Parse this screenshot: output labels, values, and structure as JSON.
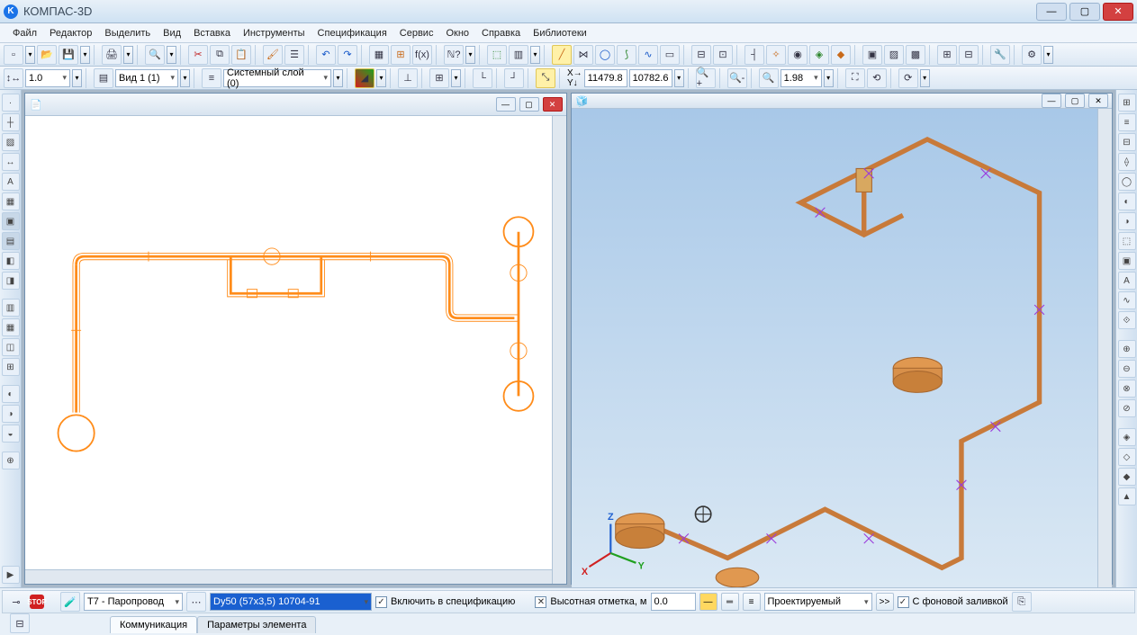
{
  "app": {
    "title": "КОМПАС-3D"
  },
  "menu": [
    "Файл",
    "Редактор",
    "Выделить",
    "Вид",
    "Вставка",
    "Инструменты",
    "Спецификация",
    "Сервис",
    "Окно",
    "Справка",
    "Библиотеки"
  ],
  "toolbar2": {
    "scale": "1.0",
    "view": "Вид 1 (1)",
    "layer": "Системный слой (0)",
    "coord_x": "11479.8",
    "coord_y": "10782.6",
    "zoom": "1.98"
  },
  "params": {
    "system": "Т7 - Паропровод",
    "pipe_spec": "Dy50 (57x3,5) 10704-91",
    "include_spec": "Включить в спецификацию",
    "elev_label": "Высотная отметка, м",
    "elev_value": "0.0",
    "status": "Проектируемый",
    "bg_fill": "С фоновой заливкой"
  },
  "tabs": {
    "t1": "Коммуникация",
    "t2": "Параметры элемента"
  },
  "axis": {
    "x": "X",
    "y": "Y",
    "z": "Z"
  },
  "icons": {
    "logo": "K",
    "new": "▢",
    "open": "📂",
    "save": "💾",
    "print": "🖨",
    "cut": "✂",
    "copy": "⧉",
    "paste": "📋",
    "undo": "↶",
    "redo": "↷",
    "fx": "f(x)",
    "help": "?",
    "arrow": "⮕",
    "minus": "—",
    "box": "▢",
    "close": "✕",
    "flask": "⚗",
    "more": ">>",
    "stop": "STOP",
    "expand": "⊕",
    "check": "✓",
    "dropdown": "▾",
    "grip": "⋮",
    "min": "—",
    "max": "▢"
  },
  "colors": {
    "pipe": "#ff8c1a",
    "accent3d": "#c87a3a",
    "purple": "#9a3adc"
  }
}
